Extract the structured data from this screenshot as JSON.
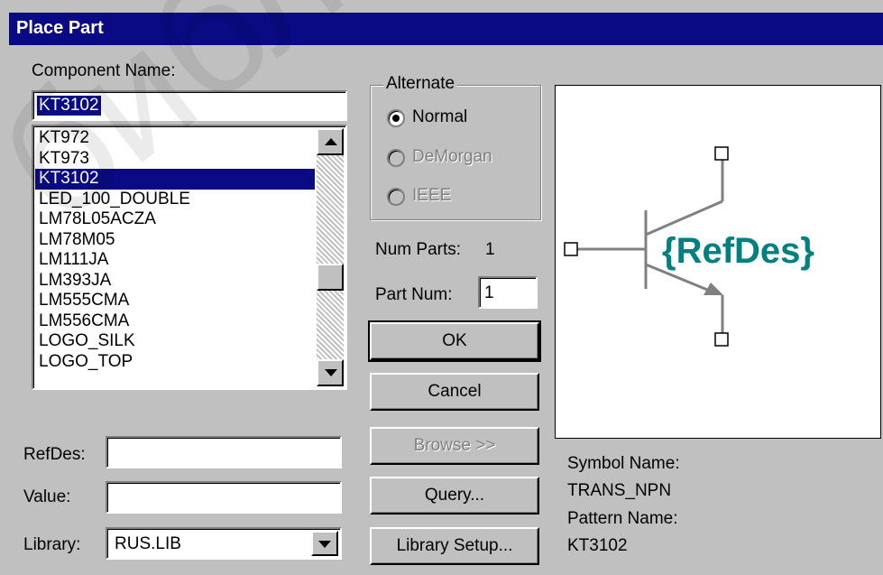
{
  "window": {
    "title": "Place Part"
  },
  "component": {
    "label": "Component Name:",
    "value": "KT3102",
    "list": [
      "KT972",
      "KT973",
      "KT3102",
      "LED_100_DOUBLE",
      "LM78L05ACZA",
      "LM78M05",
      "LM111JA",
      "LM393JA",
      "LM555CMA",
      "LM556CMA",
      "LOGO_SILK",
      "LOGO_TOP"
    ],
    "selected_index": 2
  },
  "alternate": {
    "label": "Alternate",
    "options": [
      {
        "label": "Normal",
        "checked": true,
        "enabled": true
      },
      {
        "label": "DeMorgan",
        "checked": false,
        "enabled": false
      },
      {
        "label": "IEEE",
        "checked": false,
        "enabled": false
      }
    ]
  },
  "num_parts": {
    "label": "Num Parts:",
    "value": "1"
  },
  "part_num": {
    "label": "Part Num:",
    "value": "1"
  },
  "buttons": {
    "ok": "OK",
    "cancel": "Cancel",
    "browse": "Browse >>",
    "query": "Query...",
    "library_setup": "Library Setup..."
  },
  "preview": {
    "refdes_text": "{RefDes}",
    "refdes_color": "#008080"
  },
  "symbol": {
    "symbol_label": "Symbol Name:",
    "symbol_value": "TRANS_NPN",
    "pattern_label": "Pattern Name:",
    "pattern_value": "KT3102"
  },
  "fields": {
    "refdes_label": "RefDes:",
    "refdes_value": "",
    "value_label": "Value:",
    "value_value": "",
    "library_label": "Library:",
    "library_value": "RUS.LIB"
  },
  "watermark": "библиотека"
}
